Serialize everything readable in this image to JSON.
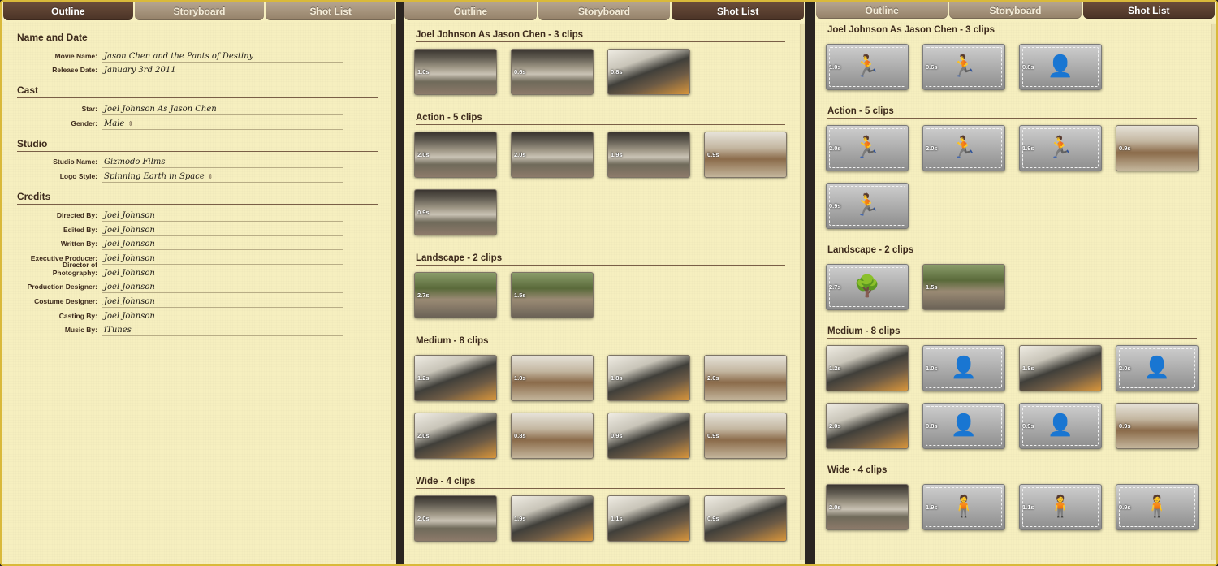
{
  "tabs": [
    "Outline",
    "Storyboard",
    "Shot List"
  ],
  "outline": {
    "sections": [
      {
        "title": "Name and Date",
        "fields": [
          {
            "label": "Movie Name:",
            "value": "Jason Chen and the Pants of Destiny"
          },
          {
            "label": "Release Date:",
            "value": "January 3rd 2011"
          }
        ]
      },
      {
        "title": "Cast",
        "fields": [
          {
            "label": "Star:",
            "value": "Joel Johnson As Jason Chen"
          },
          {
            "label": "Gender:",
            "value": "Male",
            "stepper": true
          }
        ]
      },
      {
        "title": "Studio",
        "fields": [
          {
            "label": "Studio Name:",
            "value": "Gizmodo Films"
          },
          {
            "label": "Logo Style:",
            "value": "Spinning Earth in Space",
            "stepper": true
          }
        ]
      },
      {
        "title": "Credits",
        "fields": [
          {
            "label": "Directed By:",
            "value": "Joel Johnson"
          },
          {
            "label": "Edited By:",
            "value": "Joel Johnson"
          },
          {
            "label": "Written By:",
            "value": "Joel Johnson"
          },
          {
            "label": "Executive Producer:",
            "value": "Joel Johnson"
          },
          {
            "label": "Director of Photography:",
            "value": "Joel Johnson"
          },
          {
            "label": "Production Designer:",
            "value": "Joel Johnson"
          },
          {
            "label": "Costume Designer:",
            "value": "Joel Johnson"
          },
          {
            "label": "Casting By:",
            "value": "Joel Johnson"
          },
          {
            "label": "Music By:",
            "value": "iTunes"
          }
        ]
      }
    ]
  },
  "stepper_glyph": "⇕",
  "storyboard": [
    {
      "title": "Joel Johnson As Jason Chen - 3 clips",
      "clips": [
        {
          "dur": "1.0s",
          "v": "real"
        },
        {
          "dur": "0.6s",
          "v": "real"
        },
        {
          "dur": "0.8s",
          "v": "real v2"
        }
      ]
    },
    {
      "title": "Action - 5 clips",
      "clips": [
        {
          "dur": "2.0s",
          "v": "real"
        },
        {
          "dur": "2.0s",
          "v": "real"
        },
        {
          "dur": "1.9s",
          "v": "real"
        },
        {
          "dur": "0.9s",
          "v": "real v4"
        },
        {
          "dur": "0.9s",
          "v": "real"
        }
      ]
    },
    {
      "title": "Landscape - 2 clips",
      "clips": [
        {
          "dur": "2.7s",
          "v": "real v3"
        },
        {
          "dur": "1.5s",
          "v": "real v3"
        }
      ]
    },
    {
      "title": "Medium - 8 clips",
      "clips": [
        {
          "dur": "1.2s",
          "v": "real v2"
        },
        {
          "dur": "1.0s",
          "v": "real v4"
        },
        {
          "dur": "1.8s",
          "v": "real v2"
        },
        {
          "dur": "2.0s",
          "v": "real v4"
        },
        {
          "dur": "2.0s",
          "v": "real v2"
        },
        {
          "dur": "0.8s",
          "v": "real v4"
        },
        {
          "dur": "0.9s",
          "v": "real v2"
        },
        {
          "dur": "0.9s",
          "v": "real v4"
        }
      ]
    },
    {
      "title": "Wide - 4 clips",
      "clips": [
        {
          "dur": "2.0s",
          "v": "real"
        },
        {
          "dur": "1.9s",
          "v": "real v2"
        },
        {
          "dur": "1.1s",
          "v": "real v2"
        },
        {
          "dur": "0.9s",
          "v": "real v2"
        }
      ]
    }
  ],
  "shotlist": [
    {
      "title": "Joel Johnson As Jason Chen - 3 clips",
      "clips": [
        {
          "dur": "1.0s",
          "ph": "run"
        },
        {
          "dur": "0.6s",
          "ph": "run"
        },
        {
          "dur": "0.8s",
          "ph": "head"
        }
      ]
    },
    {
      "title": "Action - 5 clips",
      "clips": [
        {
          "dur": "2.0s",
          "ph": "run"
        },
        {
          "dur": "2.0s",
          "ph": "run"
        },
        {
          "dur": "1.9s",
          "ph": "run"
        },
        {
          "dur": "0.9s",
          "v": "real v4"
        },
        {
          "dur": "0.9s",
          "ph": "run"
        }
      ]
    },
    {
      "title": "Landscape - 2 clips",
      "clips": [
        {
          "dur": "2.7s",
          "ph": "tree"
        },
        {
          "dur": "1.5s",
          "v": "real v3"
        }
      ]
    },
    {
      "title": "Medium - 8 clips",
      "clips": [
        {
          "dur": "1.2s",
          "v": "real v2"
        },
        {
          "dur": "1.0s",
          "ph": "body"
        },
        {
          "dur": "1.8s",
          "v": "real v2"
        },
        {
          "dur": "2.0s",
          "ph": "body"
        },
        {
          "dur": "2.0s",
          "v": "real v2"
        },
        {
          "dur": "0.8s",
          "ph": "body"
        },
        {
          "dur": "0.9s",
          "ph": "body"
        },
        {
          "dur": "0.9s",
          "v": "real v4"
        }
      ]
    },
    {
      "title": "Wide - 4 clips",
      "clips": [
        {
          "dur": "2.0s",
          "v": "real"
        },
        {
          "dur": "1.9s",
          "ph": "stand"
        },
        {
          "dur": "1.1s",
          "ph": "stand"
        },
        {
          "dur": "0.9s",
          "ph": "stand"
        }
      ]
    }
  ],
  "icons": {
    "run": "🏃",
    "head": "👤",
    "tree": "🌳",
    "body": "👤",
    "stand": "🧍"
  }
}
